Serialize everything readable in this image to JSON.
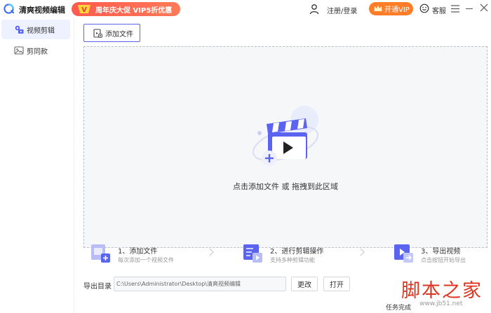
{
  "app": {
    "name": "清爽视频编辑",
    "logo_icon": "app-logo-icon",
    "promo_text": "周年庆大促 VIP5折优惠",
    "promo_badge": "V",
    "login_label": "注册/登录",
    "vip_label": "开通VIP",
    "service_label": "客服",
    "accent_color": "#5b64f0",
    "vip_color": "#ff7d28",
    "promo_color": "#ff5a4f"
  },
  "sidebar": {
    "items": [
      {
        "label": "视频剪辑",
        "icon": "video-edit-icon",
        "active": true
      },
      {
        "label": "剪同款",
        "icon": "image-template-icon",
        "active": false
      }
    ]
  },
  "main": {
    "add_file_label": "添加文件",
    "drop_text": "点击添加文件 或 拖拽到此区域",
    "steps": [
      {
        "title": "1、添加文件",
        "desc": "每次添加一个视频文件"
      },
      {
        "title": "2、进行剪辑操作",
        "desc": "支持多种剪辑功能"
      },
      {
        "title": "3、导出视频",
        "desc": "点击按钮开始导出"
      }
    ],
    "export_label": "导出目录",
    "export_path": "C:\\Users\\Administrator\\Desktop\\清爽视频编辑",
    "change_label": "更改",
    "open_label": "打开",
    "task_label": "任务完成"
  },
  "watermark": {
    "big": "脚本之家",
    "small": "www.jb51.net"
  }
}
